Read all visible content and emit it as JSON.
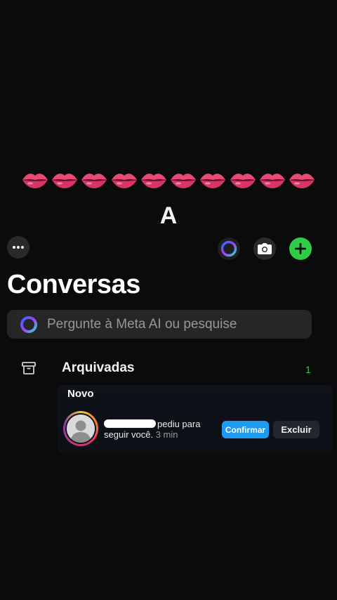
{
  "header": {
    "emoji_row": [
      "lips",
      "lips",
      "lips",
      "lips",
      "lips",
      "lips",
      "lips",
      "lips",
      "lips",
      "lips"
    ],
    "big_letter": "A"
  },
  "toolbar": {
    "icons": [
      "more-icon",
      "meta-ai-icon",
      "camera-icon",
      "plus-icon"
    ],
    "accent": "#2fcd46"
  },
  "title": "Conversas",
  "search": {
    "placeholder": "Pergunte à Meta AI ou pesquise"
  },
  "archived": {
    "label": "Arquivadas",
    "count": "1"
  },
  "follow_request": {
    "section_title": "Novo",
    "text_part1": "pediu para",
    "text_part2": "seguir você.",
    "time": "3 min",
    "confirm_label": "Confirmar",
    "delete_label": "Excluir",
    "confirm_color": "#1d9bf0"
  }
}
